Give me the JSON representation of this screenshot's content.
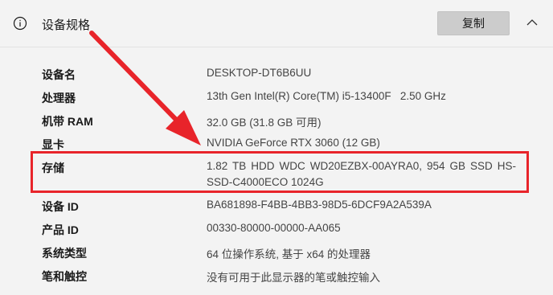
{
  "header": {
    "icon": "info-icon",
    "title": "设备规格",
    "copy_label": "复制",
    "collapse_icon": "chevron-up-icon"
  },
  "specs": [
    {
      "label": "设备名",
      "value": "DESKTOP-DT6B6UU"
    },
    {
      "label": "处理器",
      "value": "13th Gen Intel(R) Core(TM) i5-13400F   2.50 GHz"
    },
    {
      "label": "机带 RAM",
      "value": "32.0 GB (31.8 GB 可用)"
    },
    {
      "label": "显卡",
      "value": "NVIDIA GeForce RTX 3060 (12 GB)"
    },
    {
      "label": "存储",
      "value": "1.82 TB HDD WDC WD20EZBX-00AYRA0, 954 GB SSD HS-SSD-C4000ECO 1024G"
    },
    {
      "label": "设备 ID",
      "value": "BA681898-F4BB-4BB3-98D5-6DCF9A2A539A"
    },
    {
      "label": "产品 ID",
      "value": "00330-80000-00000-AA065"
    },
    {
      "label": "系统类型",
      "value": "64 位操作系统, 基于 x64 的处理器"
    },
    {
      "label": "笔和触控",
      "value": "没有可用于此显示器的笔或触控输入"
    }
  ],
  "annotation": {
    "color": "#e8242a",
    "highlighted_row": "存储"
  }
}
